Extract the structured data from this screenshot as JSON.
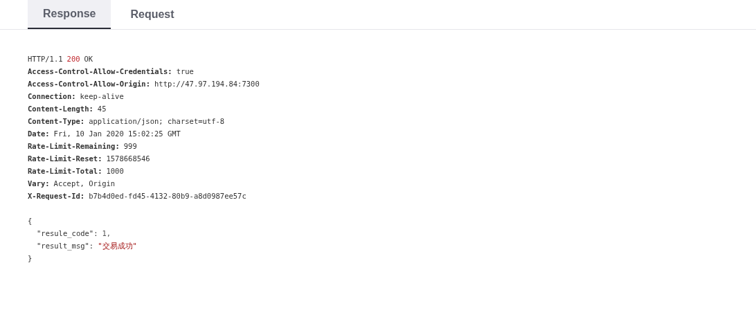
{
  "tabs": [
    {
      "label": "Response",
      "selected": true
    },
    {
      "label": "Request",
      "selected": false
    }
  ],
  "status_line": {
    "protocol": "HTTP/1.1",
    "code": "200",
    "reason": "OK"
  },
  "headers": [
    {
      "name": "Access-Control-Allow-Credentials:",
      "value": "true"
    },
    {
      "name": "Access-Control-Allow-Origin:",
      "value": "http://47.97.194.84:7300"
    },
    {
      "name": "Connection:",
      "value": "keep-alive"
    },
    {
      "name": "Content-Length:",
      "value": "45"
    },
    {
      "name": "Content-Type:",
      "value": "application/json; charset=utf-8"
    },
    {
      "name": "Date:",
      "value": "Fri, 10 Jan 2020 15:02:25 GMT"
    },
    {
      "name": "Rate-Limit-Remaining:",
      "value": "999"
    },
    {
      "name": "Rate-Limit-Reset:",
      "value": "1578668546"
    },
    {
      "name": "Rate-Limit-Total:",
      "value": "1000"
    },
    {
      "name": "Vary:",
      "value": "Accept, Origin"
    },
    {
      "name": "X-Request-Id:",
      "value": "b7b4d0ed-fd45-4132-80b9-a8d0987ee57c"
    }
  ],
  "body": [
    {
      "kind": "punct",
      "text": "{"
    },
    {
      "kind": "number",
      "key": "\"resule_code\":",
      "value": "1,"
    },
    {
      "kind": "string",
      "key": "\"result_msg\":",
      "value": "\"交易成功\""
    },
    {
      "kind": "punct",
      "text": "}"
    }
  ]
}
